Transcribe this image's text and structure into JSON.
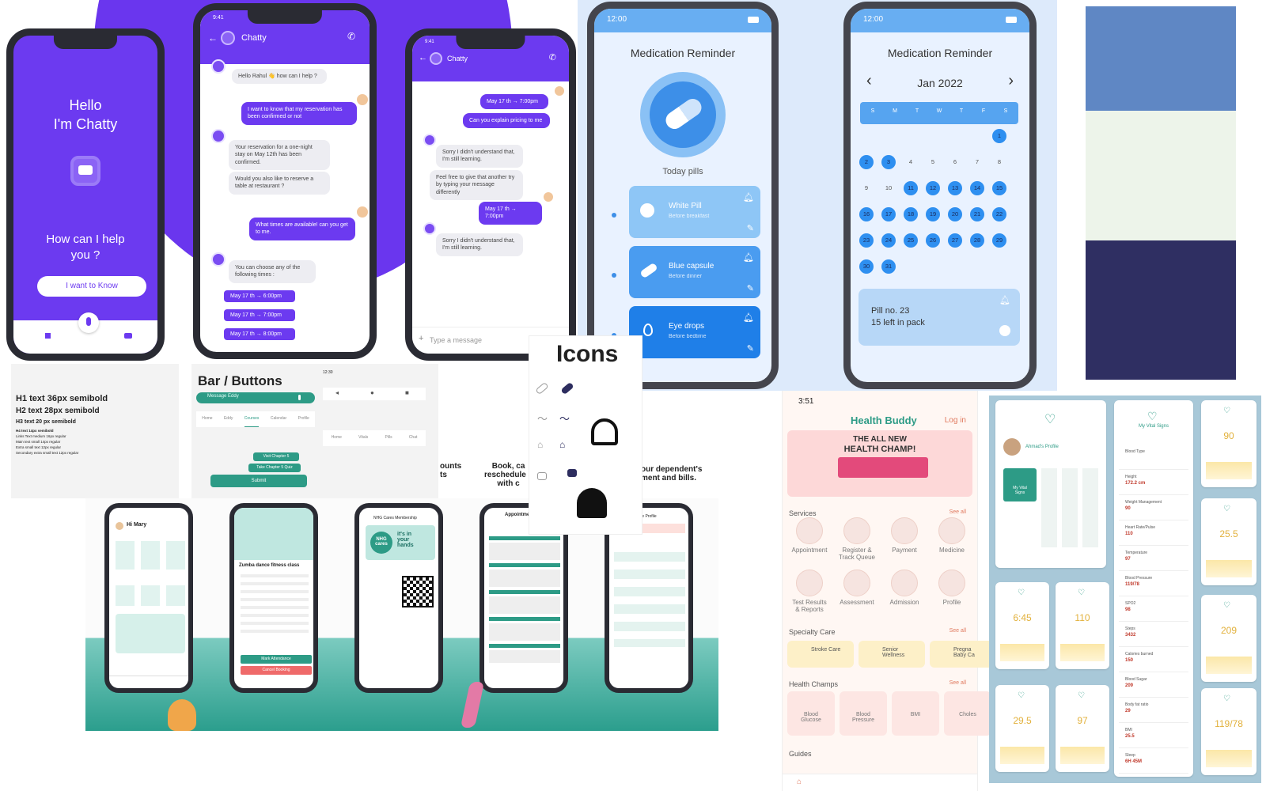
{
  "chatty": {
    "status_time": "9:41",
    "greeting_line1": "Hello",
    "greeting_line2": "I'm Chatty",
    "help_line1": "How can I help",
    "help_line2": "you ?",
    "cta": "I want to Know",
    "header_name": "Chatty",
    "msg_hello": "Hello Rahul 👋 how can I help ?",
    "msg_user1": "I want to know that my reservation has been confirmed or not",
    "msg_confirm": "Your reservation for a one-night stay on May 12th has been confirmed.",
    "msg_reserve": "Would you also like to reserve a table at restaurant ?",
    "msg_user2": "What times are available! can you get to me.",
    "msg_choose": "You can choose any of the following times :",
    "slot1": "May 17 th  →  6:00pm",
    "slot2": "May 17 th  →  7:00pm",
    "slot3": "May 17 th  →  8:00pm",
    "r_user1": "May 17 th  →  7:00pm",
    "r_user2": "Can you explain pricing to me",
    "r_bot1": "Sorry I didn't understand that, I'm still learning.",
    "r_bot2": "Feel free to give that another try by typing your message differently",
    "r_user3": "May 17 th  →  7:00pm",
    "r_bot3": "Sorry I didn't understand that, I'm still learning.",
    "type_placeholder": "Type a message"
  },
  "medication": {
    "time": "12:00",
    "title": "Medication Reminder",
    "today": "Today pills",
    "pills": [
      {
        "name": "White Pill",
        "note": "Before breakfast"
      },
      {
        "name": "Blue capsule",
        "note": "Before dinner"
      },
      {
        "name": "Eye drops",
        "note": "Before bedtime"
      }
    ],
    "month": "Jan 2022",
    "weekdays": [
      "S",
      "M",
      "T",
      "W",
      "T",
      "F",
      "S"
    ],
    "pill_line1": "Pill no. 23",
    "pill_line2": "15 left in pack"
  },
  "palette": [
    "#5f87c4",
    "#edf4ea",
    "#2f2f62"
  ],
  "typography": {
    "h1": "H1 text 36px semibold",
    "h2": "H2 text 28px semibold",
    "h3": "H3 text 20 px semibold",
    "lines": [
      "H4 text 14px semibold",
      "Links Text medium 16px regular",
      "Main text small 14px regular",
      "Extra small text 12px regular",
      "Secondary extra small text 12px regular"
    ]
  },
  "bars": {
    "title": "Bar / Buttons",
    "time": "12:30",
    "search": "Message Eddy",
    "nav1": [
      "Home",
      "Eddy",
      "Courses",
      "Calendar",
      "Profile"
    ],
    "nav2": [
      "Home",
      "Vitals",
      "Pills",
      "Chat"
    ],
    "btn1": "Visit Chapter 5",
    "btn2": "Take Chapter 5 Quiz",
    "btn3": "Submit"
  },
  "icons": {
    "title": "Icons"
  },
  "nhg": {
    "partial1": "ounts\nts",
    "partial2": "Book, ca\nreschedule a\nwith c",
    "partial3": "our dependent's\nment and bills.",
    "greet": "Hi Mary",
    "event": "Zumba dance fitness class",
    "membership": "NHG Cares Membership",
    "logo1": "NHG\ncares",
    "logo2": "it's in\nyour\nhands",
    "mark_btn": "Mark Attendance",
    "cancel_btn": "Cancel Booking",
    "appts": "Appointments",
    "profile": "Manage Profile"
  },
  "health": {
    "time": "3:51",
    "brand": "Health Buddy",
    "login": "Log in",
    "banner1": "THE ALL NEW",
    "banner2": "HEALTH CHAMP!",
    "services": "Services",
    "see_all": "See all",
    "icons1": [
      "Appointment",
      "Register &\nTrack Queue",
      "Payment",
      "Medicine"
    ],
    "icons2": [
      "Test Results\n& Reports",
      "Assessment",
      "Admission",
      "Profile"
    ],
    "specialty": "Specialty Care",
    "spec_items": [
      "Stroke Care",
      "Senior\nWellness",
      "Pregna\nBaby Ca"
    ],
    "champs": "Health Champs",
    "champ_items": [
      "Blood\nGlucose",
      "Blood\nPressure",
      "BMI",
      "Choles"
    ],
    "guides": "Guides"
  },
  "vitals": {
    "profile_name": "Ahmad's Profile",
    "title": "My Vital Signs",
    "vital_tile": "My Vital\nSigns",
    "rows": [
      "Blood Type",
      "Height",
      "Weight Management",
      "Heart Rate/Pulse",
      "Temperature",
      "Blood Pressure",
      "SPO2",
      "Steps",
      "Calories burned",
      "Blood Sugar",
      "Body fat ratio",
      "BMI",
      "Sleep"
    ],
    "values": [
      "90",
      "25.5",
      "209",
      "119/78",
      "6:45",
      "110",
      "29.5",
      "97"
    ],
    "row_vals": [
      "172.2 cm",
      "90",
      "110",
      "97",
      "119/78",
      "98",
      "3432",
      "150",
      "209",
      "29",
      "25.5",
      "6H 45M"
    ]
  }
}
